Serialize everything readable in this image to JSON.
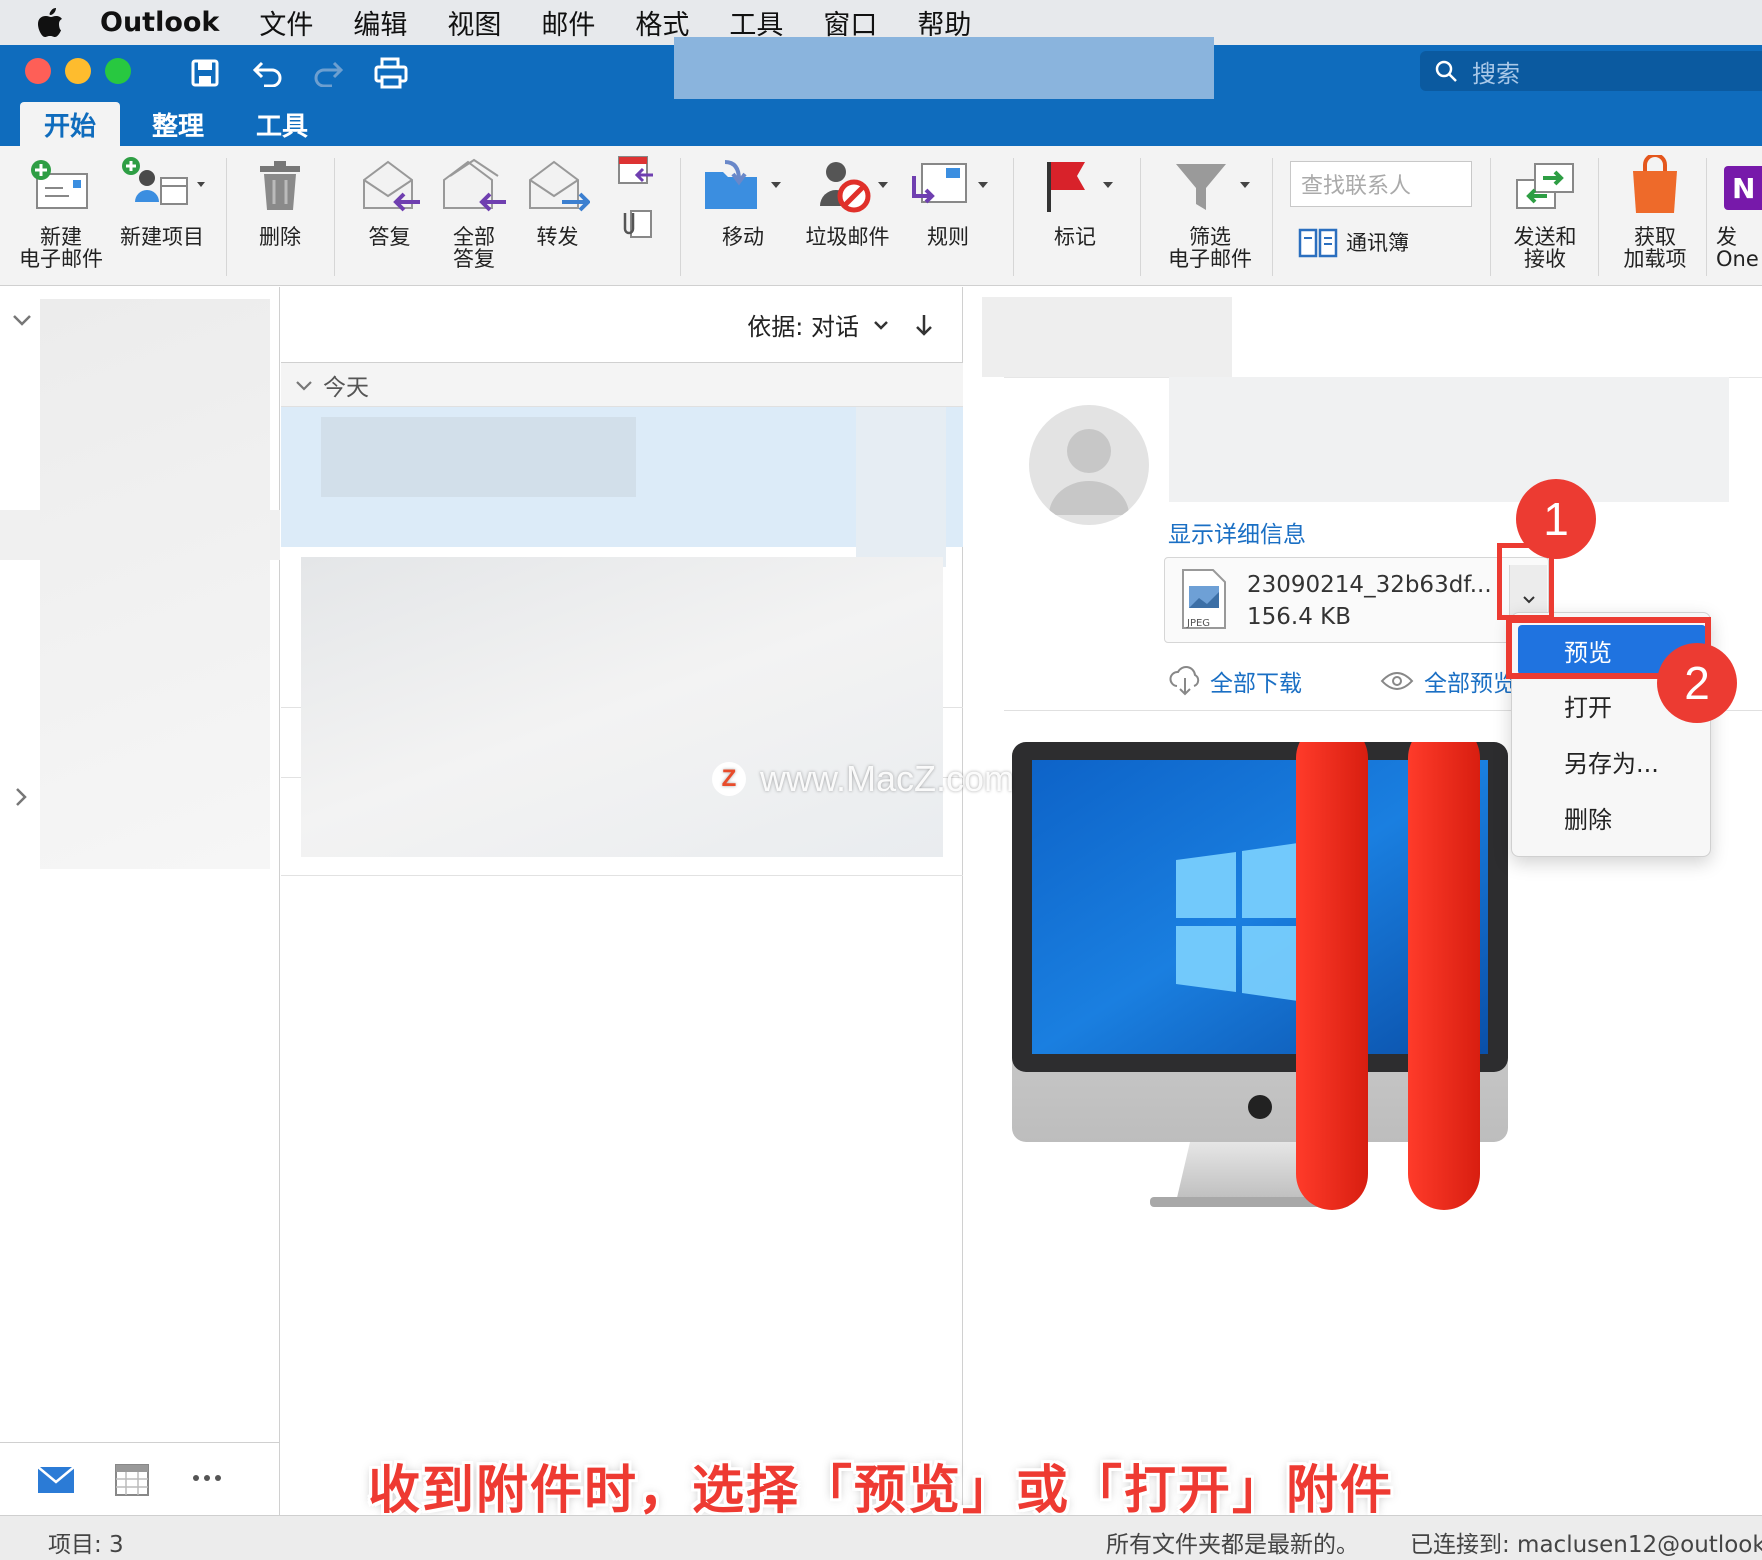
{
  "menubar": {
    "app_name": "Outlook",
    "items": [
      "文件",
      "编辑",
      "视图",
      "邮件",
      "格式",
      "工具",
      "窗口",
      "帮助"
    ]
  },
  "titlebar": {
    "search_placeholder": "搜索"
  },
  "ribbon_tabs": [
    "开始",
    "整理",
    "工具"
  ],
  "ribbon": {
    "new_email": "新建\n电子邮件",
    "new_item": "新建项目",
    "delete": "删除",
    "reply": "答复",
    "reply_all": "全部\n答复",
    "forward": "转发",
    "move": "移动",
    "junk": "垃圾邮件",
    "rules": "规则",
    "flag": "标记",
    "filter": "筛选\n电子邮件",
    "find_contact_placeholder": "查找联系人",
    "address_book": "通讯簿",
    "send_receive": "发送和\n接收",
    "get_addins": "获取\n加载项",
    "onenote": "发\nOne"
  },
  "message_list": {
    "sort_label": "依据: 对话",
    "group_header": "今天"
  },
  "reading_pane": {
    "show_details": "显示详细信息",
    "attachment": {
      "name": "23090214_32b63df...",
      "size": "156.4 KB",
      "type_label": "JPEG"
    },
    "download_all": "全部下载",
    "preview_all": "全部预览"
  },
  "context_menu": {
    "items": [
      "预览",
      "打开",
      "另存为...",
      "删除"
    ],
    "highlighted": "预览"
  },
  "annotations": {
    "badge1": "1",
    "badge2": "2",
    "caption": "收到附件时，选择「预览」或「打开」附件",
    "watermark": "www.MacZ.com",
    "watermark_logo": "Z",
    "accent_color": "#ec3b32"
  },
  "statusbar": {
    "items": "项目: 3",
    "sync": "所有文件夹都是最新的。",
    "connected": "已连接到: maclusen12@outlook"
  },
  "colors": {
    "brand_blue": "#0f6cbd",
    "selection_blue": "#1f73e0"
  }
}
